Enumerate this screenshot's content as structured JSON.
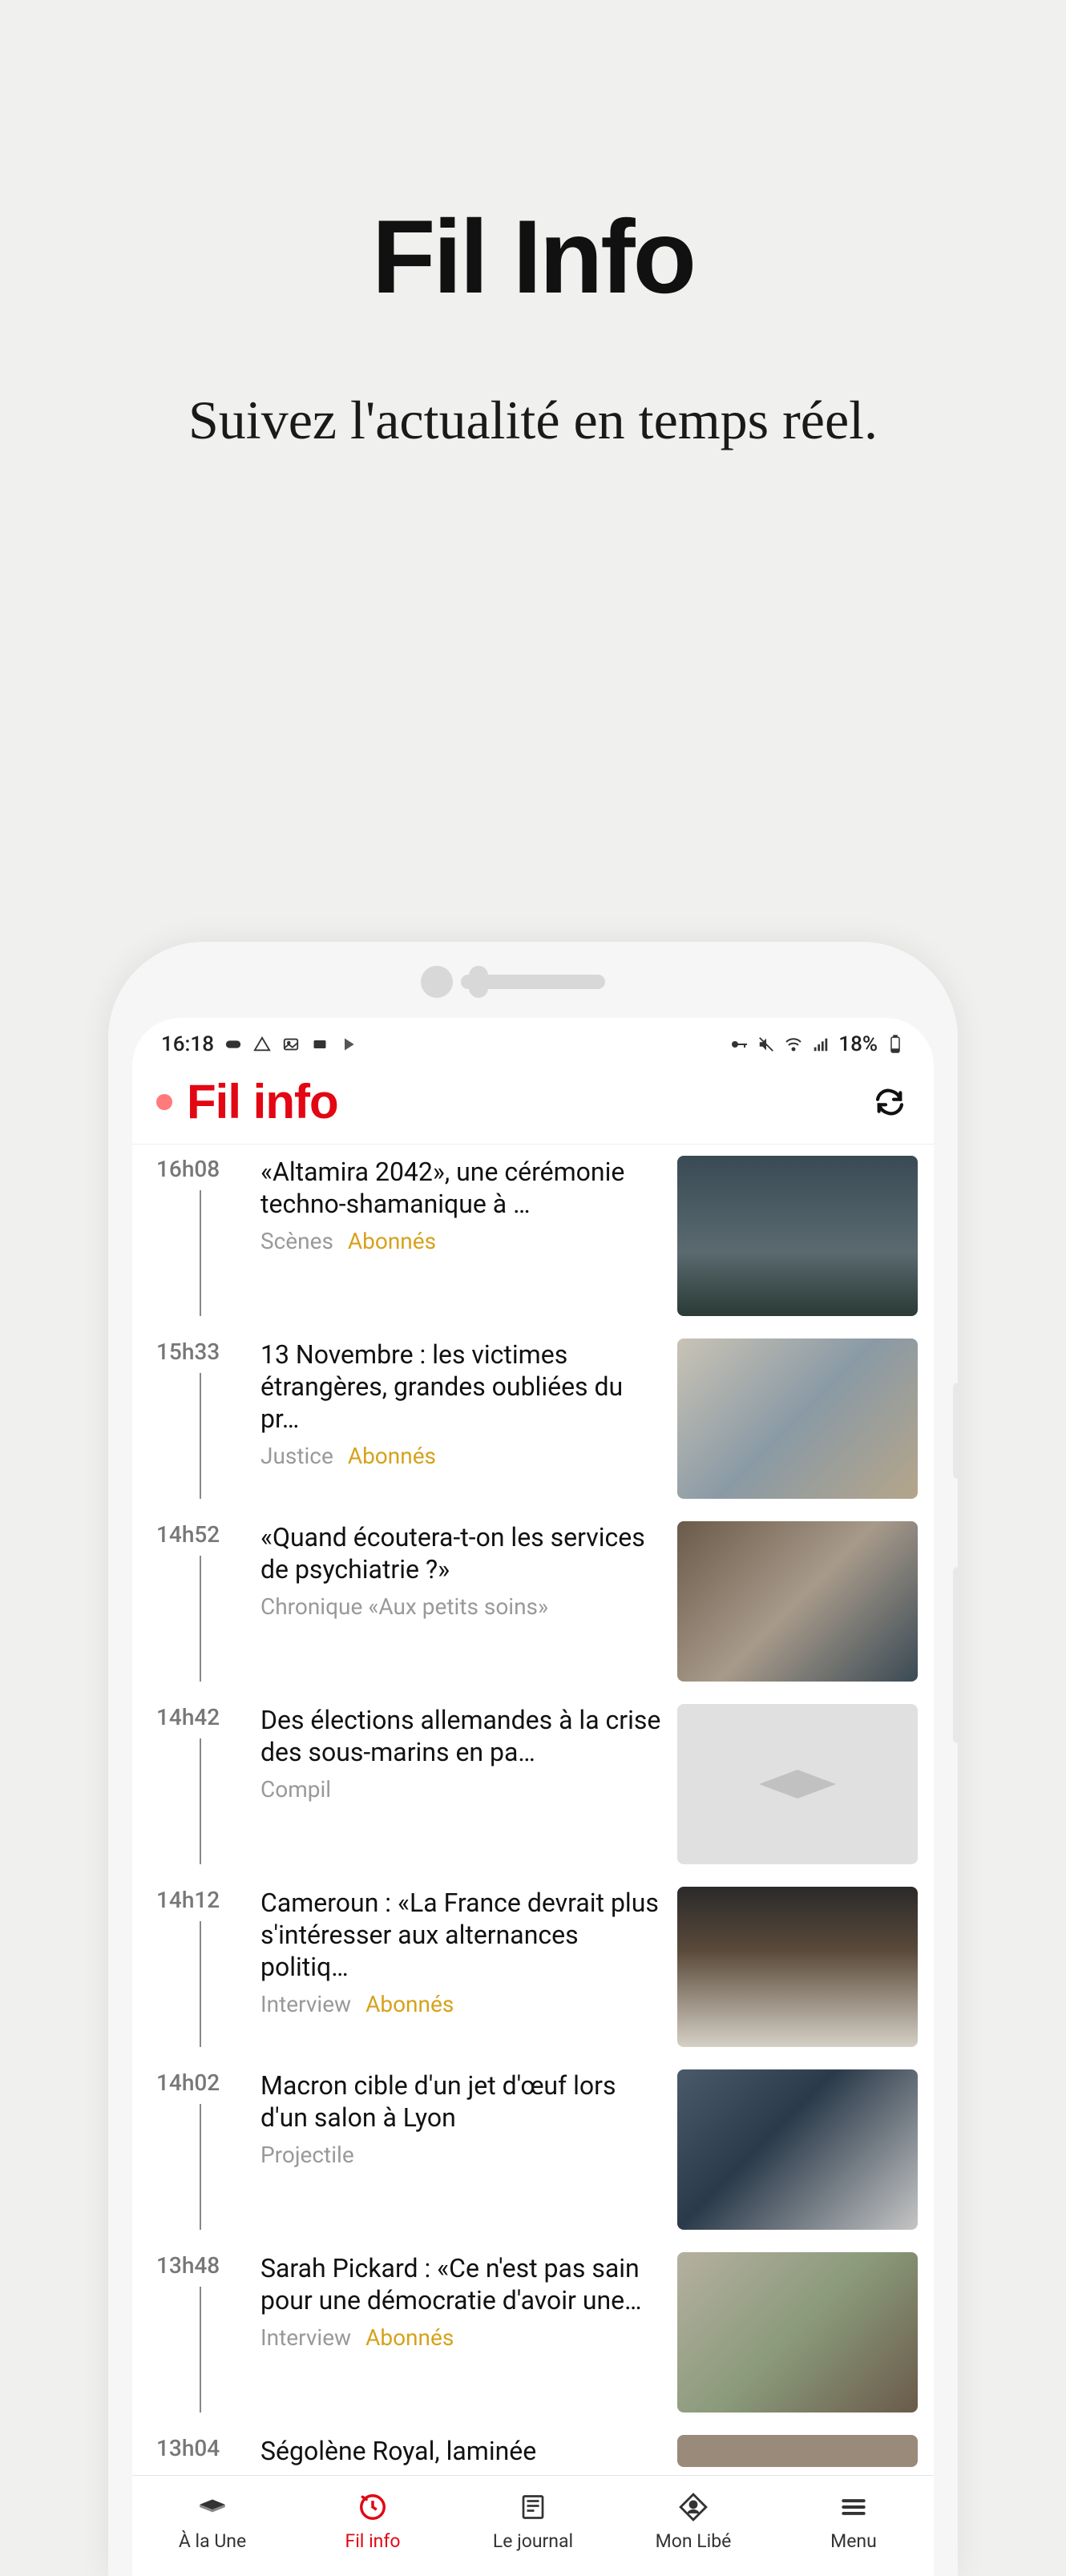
{
  "hero": {
    "title": "Fil Info",
    "subtitle": "Suivez l'actualité en\ntemps réel."
  },
  "status_bar": {
    "time": "16:18",
    "battery": "18%"
  },
  "header": {
    "title": "Fil info"
  },
  "feed": [
    {
      "time": "16h08",
      "headline": "«Altamira 2042», une cérémonie techno-shamanique à …",
      "category": "Scènes",
      "subscriber": "Abonnés",
      "thumb_bg": "linear-gradient(180deg,#3a4a55 0%,#5a6a6f 60%,#2a3a35 100%)"
    },
    {
      "time": "15h33",
      "headline": "13 Novembre : les victimes étrangères, grandes oubliées du pr…",
      "category": "Justice",
      "subscriber": "Abonnés",
      "thumb_bg": "linear-gradient(135deg,#c9c3b5 0%,#8a9aa5 50%,#b5a58a 100%)"
    },
    {
      "time": "14h52",
      "headline": "«Quand écoutera-t-on les services de psychiatrie ?»",
      "category": "Chronique «Aux petits soins»",
      "subscriber": "",
      "thumb_bg": "linear-gradient(135deg,#6a5a4a 0%,#a89a8a 50%,#3a4a55 100%)"
    },
    {
      "time": "14h42",
      "headline": "Des élections allemandes à la crise des sous-marins en pa…",
      "category": "Compil",
      "subscriber": "",
      "thumb_bg": "placeholder"
    },
    {
      "time": "14h12",
      "headline": "Cameroun : «La France devrait plus s'intéresser aux alternances politiq…",
      "category": "Interview",
      "subscriber": "Abonnés",
      "thumb_bg": "linear-gradient(180deg,#2a2a2a 0%,#5a4a3a 40%,#d5d0c5 100%)"
    },
    {
      "time": "14h02",
      "headline": "Macron cible d'un jet d'œuf lors d'un salon à Lyon",
      "category": "Projectile",
      "subscriber": "",
      "thumb_bg": "linear-gradient(135deg,#4a5a6a 0%,#2a3a4a 40%,#c5c5c5 100%)"
    },
    {
      "time": "13h48",
      "headline": "Sarah Pickard : «Ce n'est pas sain pour une démocratie d'avoir une…",
      "category": "Interview",
      "subscriber": "Abonnés",
      "thumb_bg": "linear-gradient(135deg,#b5b0a0 0%,#8a9a7a 50%,#6a5a4a 100%)"
    },
    {
      "time": "13h04",
      "headline": "Ségolène Royal, laminée",
      "category": "",
      "subscriber": "",
      "thumb_bg": "#9a8a7a",
      "partial": true
    }
  ],
  "nav": [
    {
      "label": "À la Une",
      "active": false
    },
    {
      "label": "Fil info",
      "active": true
    },
    {
      "label": "Le journal",
      "active": false
    },
    {
      "label": "Mon Libé",
      "active": false
    },
    {
      "label": "Menu",
      "active": false
    }
  ]
}
